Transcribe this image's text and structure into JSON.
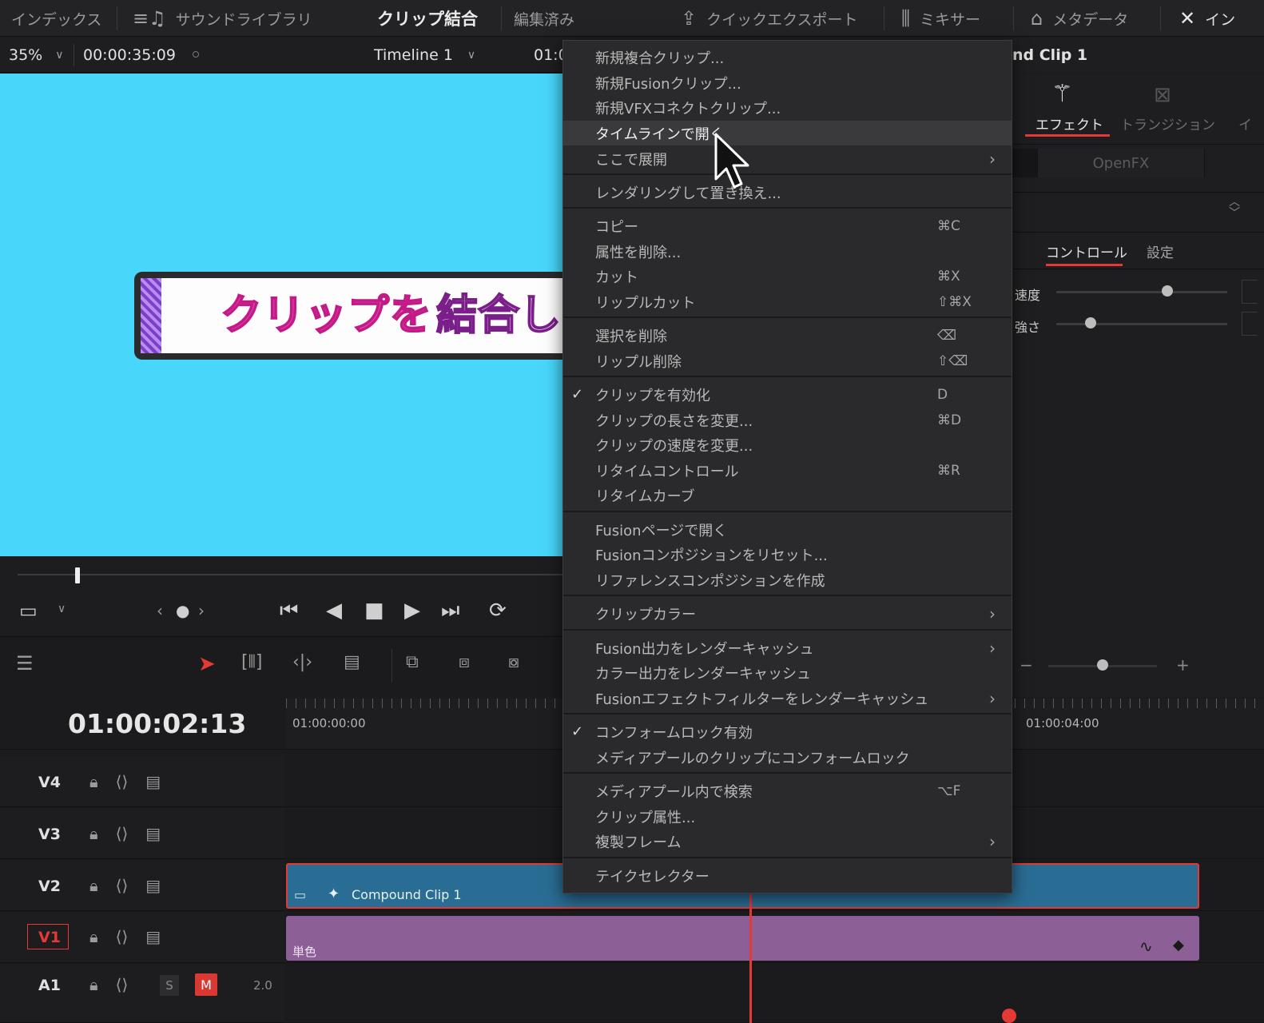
{
  "topbar": {
    "index": "インデックス",
    "sound_library": "サウンドライブラリ",
    "title": "クリップ結合",
    "status": "編集済み",
    "quick_export": "クイックエクスポート",
    "mixer": "ミキサー",
    "metadata": "メタデータ",
    "inspector": "イン"
  },
  "viewer": {
    "zoom": "35%",
    "timecode": "00:00:35:09",
    "timeline_name": "Timeline 1",
    "timeline_tc_partial": "01:0",
    "title_text_a": "クリップを",
    "title_text_b": "結合し"
  },
  "inspector": {
    "clip_title_partial": "nd Clip 1",
    "tab_effects": "エフェクト",
    "tab_transitions": "トランジション",
    "tab_partial": "イ",
    "openfx": "OpenFX",
    "subtab_control": "コントロール",
    "subtab_settings": "設定",
    "param_speed": "速度",
    "param_strength": "強さ",
    "speed_value": 0.65,
    "strength_value": 0.2,
    "zoom_slider_value": 0.5
  },
  "timeline": {
    "timecode": "01:00:02:13",
    "ruler_start": "01:00:00:00",
    "ruler_mid": "01:00:04:00",
    "tracks": [
      {
        "name": "V4"
      },
      {
        "name": "V3"
      },
      {
        "name": "V2"
      },
      {
        "name": "V1"
      },
      {
        "name": "A1"
      }
    ],
    "a1_solo": "S",
    "a1_mute": "M",
    "a1_level": "2.0",
    "clip_v2": "Compound Clip 1",
    "clip_v1": "単色"
  },
  "menu": {
    "items": [
      {
        "label": "新規複合クリップ..."
      },
      {
        "label": "新規Fusionクリップ..."
      },
      {
        "label": "新規VFXコネクトクリップ..."
      },
      {
        "label": "タイムラインで開く"
      },
      {
        "label": "ここで展開"
      },
      {
        "label": "レンダリングして置き換え..."
      },
      {
        "label": "コピー",
        "shortcut": "⌘C"
      },
      {
        "label": "属性を削除..."
      },
      {
        "label": "カット",
        "shortcut": "⌘X"
      },
      {
        "label": "リップルカット",
        "shortcut": "⇧⌘X"
      },
      {
        "label": "選択を削除",
        "shortcut": "⌫"
      },
      {
        "label": "リップル削除",
        "shortcut": "⇧⌫"
      },
      {
        "label": "クリップを有効化",
        "shortcut": "D"
      },
      {
        "label": "クリップの長さを変更...",
        "shortcut": "⌘D"
      },
      {
        "label": "クリップの速度を変更..."
      },
      {
        "label": "リタイムコントロール",
        "shortcut": "⌘R"
      },
      {
        "label": "リタイムカーブ"
      },
      {
        "label": "Fusionページで開く"
      },
      {
        "label": "Fusionコンポジションをリセット..."
      },
      {
        "label": "リファレンスコンポジションを作成"
      },
      {
        "label": "クリップカラー"
      },
      {
        "label": "Fusion出力をレンダーキャッシュ"
      },
      {
        "label": "カラー出力をレンダーキャッシュ"
      },
      {
        "label": "Fusionエフェクトフィルターをレンダーキャッシュ"
      },
      {
        "label": "コンフォームロック有効"
      },
      {
        "label": "メディアプールのクリップにコンフォームロック"
      },
      {
        "label": "メディアプール内で検索",
        "shortcut": "⌥F"
      },
      {
        "label": "クリップ属性..."
      },
      {
        "label": "複製フレーム"
      },
      {
        "label": "テイクセレクター"
      }
    ]
  },
  "colors": {
    "viewer_bg": "#48d7fb",
    "playhead": "#e53935",
    "clip_v2": "#2a6d94",
    "clip_v1": "#8d5f97"
  }
}
